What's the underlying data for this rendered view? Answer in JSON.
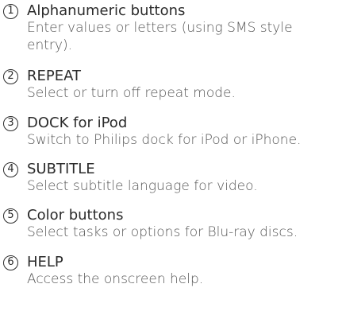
{
  "items": [
    {
      "number": "1",
      "title": "Alphanumeric buttons",
      "description": "Enter values or letters (using SMS style entry)."
    },
    {
      "number": "2",
      "title": "REPEAT",
      "description": "Select or turn off repeat mode."
    },
    {
      "number": "3",
      "title": "DOCK for iPod",
      "description": "Switch to Philips dock for iPod or iPhone."
    },
    {
      "number": "4",
      "title": "SUBTITLE",
      "description": "Select subtitle language for video."
    },
    {
      "number": "5",
      "title": "Color buttons",
      "description": "Select tasks or options for Blu-ray discs."
    },
    {
      "number": "6",
      "title": "HELP",
      "description": "Access the onscreen help."
    }
  ]
}
